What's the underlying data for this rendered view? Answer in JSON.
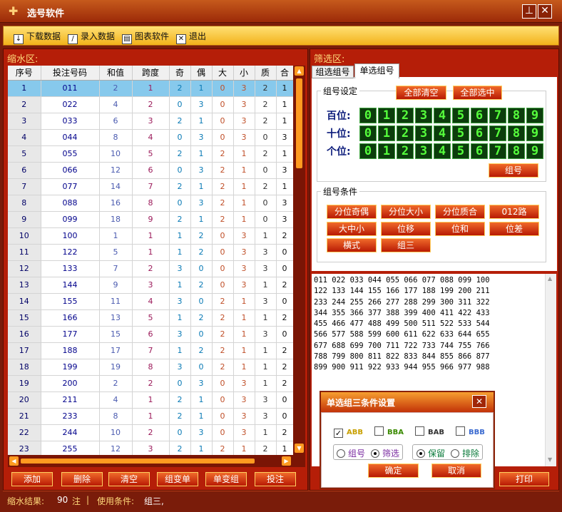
{
  "window": {
    "title": "选号软件",
    "minimize_symbol": "⊥",
    "close_symbol": "✕"
  },
  "toolbar": {
    "items": [
      {
        "label": "下载数据",
        "icon": "download-icon"
      },
      {
        "label": "录入数据",
        "icon": "pencil-icon"
      },
      {
        "label": "图表软件",
        "icon": "chart-icon"
      },
      {
        "label": "退出",
        "icon": "exit-icon"
      }
    ]
  },
  "left_panel": {
    "title": "缩水区:",
    "columns": [
      "序号",
      "投注号码",
      "和值",
      "跨度",
      "奇",
      "偶",
      "大",
      "小",
      "质",
      "合"
    ],
    "rows": [
      [
        "1",
        "011",
        "2",
        "1",
        "2",
        "1",
        "0",
        "3",
        "2",
        "1"
      ],
      [
        "2",
        "022",
        "4",
        "2",
        "0",
        "3",
        "0",
        "3",
        "2",
        "1"
      ],
      [
        "3",
        "033",
        "6",
        "3",
        "2",
        "1",
        "0",
        "3",
        "2",
        "1"
      ],
      [
        "4",
        "044",
        "8",
        "4",
        "0",
        "3",
        "0",
        "3",
        "0",
        "3"
      ],
      [
        "5",
        "055",
        "10",
        "5",
        "2",
        "1",
        "2",
        "1",
        "2",
        "1"
      ],
      [
        "6",
        "066",
        "12",
        "6",
        "0",
        "3",
        "2",
        "1",
        "0",
        "3"
      ],
      [
        "7",
        "077",
        "14",
        "7",
        "2",
        "1",
        "2",
        "1",
        "2",
        "1"
      ],
      [
        "8",
        "088",
        "16",
        "8",
        "0",
        "3",
        "2",
        "1",
        "0",
        "3"
      ],
      [
        "9",
        "099",
        "18",
        "9",
        "2",
        "1",
        "2",
        "1",
        "0",
        "3"
      ],
      [
        "10",
        "100",
        "1",
        "1",
        "1",
        "2",
        "0",
        "3",
        "1",
        "2"
      ],
      [
        "11",
        "122",
        "5",
        "1",
        "1",
        "2",
        "0",
        "3",
        "3",
        "0"
      ],
      [
        "12",
        "133",
        "7",
        "2",
        "3",
        "0",
        "0",
        "3",
        "3",
        "0"
      ],
      [
        "13",
        "144",
        "9",
        "3",
        "1",
        "2",
        "0",
        "3",
        "1",
        "2"
      ],
      [
        "14",
        "155",
        "11",
        "4",
        "3",
        "0",
        "2",
        "1",
        "3",
        "0"
      ],
      [
        "15",
        "166",
        "13",
        "5",
        "1",
        "2",
        "2",
        "1",
        "1",
        "2"
      ],
      [
        "16",
        "177",
        "15",
        "6",
        "3",
        "0",
        "2",
        "1",
        "3",
        "0"
      ],
      [
        "17",
        "188",
        "17",
        "7",
        "1",
        "2",
        "2",
        "1",
        "1",
        "2"
      ],
      [
        "18",
        "199",
        "19",
        "8",
        "3",
        "0",
        "2",
        "1",
        "1",
        "2"
      ],
      [
        "19",
        "200",
        "2",
        "2",
        "0",
        "3",
        "0",
        "3",
        "1",
        "2"
      ],
      [
        "20",
        "211",
        "4",
        "1",
        "2",
        "1",
        "0",
        "3",
        "3",
        "0"
      ],
      [
        "21",
        "233",
        "8",
        "1",
        "2",
        "1",
        "0",
        "3",
        "3",
        "0"
      ],
      [
        "22",
        "244",
        "10",
        "2",
        "0",
        "3",
        "0",
        "3",
        "1",
        "2"
      ],
      [
        "23",
        "255",
        "12",
        "3",
        "2",
        "1",
        "2",
        "1",
        "2",
        "1"
      ]
    ],
    "selected_row": 0,
    "buttons": [
      "添加",
      "删除",
      "清空",
      "组变单",
      "单变组",
      "投注"
    ]
  },
  "right_panel": {
    "title": "筛选区:",
    "tabs": [
      {
        "label": "组选组号"
      },
      {
        "label": "单选组号"
      }
    ],
    "active_tab": 1,
    "setting_group": {
      "title": "组号设定",
      "clear_all": "全部清空",
      "select_all": "全部选中",
      "rows": [
        {
          "label": "百位:"
        },
        {
          "label": "十位:"
        },
        {
          "label": "个位:"
        }
      ],
      "digits": [
        "0",
        "1",
        "2",
        "3",
        "4",
        "5",
        "6",
        "7",
        "8",
        "9"
      ],
      "action": "组号"
    },
    "condition_group": {
      "title": "组号条件",
      "buttons": [
        "分位奇偶",
        "分位大小",
        "分位质合",
        "012路",
        "大中小",
        "位移",
        "位和",
        "位差",
        "横式",
        "组三"
      ]
    },
    "result_lines": [
      "011 022 033 044 055 066 077 088 099 100",
      "122 133 144 155 166 177 188 199 200 211",
      "233 244 255 266 277 288 299 300 311 322",
      "344 355 366 377 388 399 400 411 422 433",
      "455 466 477 488 499 500 511 522 533 544",
      "566 577 588 599 600 611 622 633 644 655",
      "677 688 699 700 711 722 733 744 755 766",
      "788 799 800 811 822 833 844 855 866 877",
      "899 900 911 922 933 944 955 966 977 988"
    ],
    "print_button": "打印"
  },
  "dialog": {
    "title": "单选组三条件设置",
    "close_symbol": "✕",
    "checks": [
      {
        "label": "ABB",
        "checked": true,
        "color": "#c8a000"
      },
      {
        "label": "BBA",
        "checked": false,
        "color": "#3a8a00"
      },
      {
        "label": "BAB",
        "checked": false,
        "color": "#333333"
      },
      {
        "label": "BBB",
        "checked": false,
        "color": "#3a6ad0"
      }
    ],
    "radio1": [
      {
        "label": "组号",
        "checked": false
      },
      {
        "label": "筛选",
        "checked": true
      }
    ],
    "radio2": [
      {
        "label": "保留",
        "checked": true
      },
      {
        "label": "排除",
        "checked": false
      }
    ],
    "ok": "确定",
    "cancel": "取消"
  },
  "status": {
    "result_label": "缩水结果:",
    "count": "90",
    "unit": "注",
    "sep": "|",
    "cond_label": "使用条件:",
    "cond_value": "组三,"
  }
}
